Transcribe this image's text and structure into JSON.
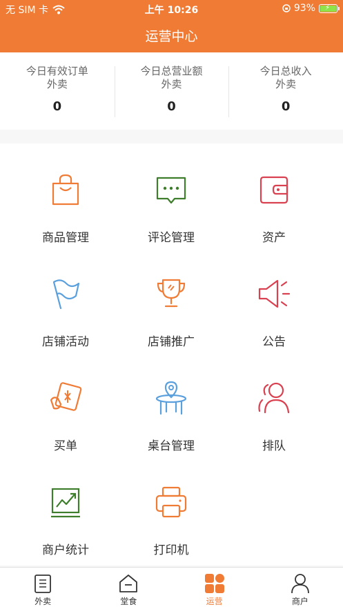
{
  "status_bar": {
    "carrier": "无 SIM 卡",
    "time": "上午 10:26",
    "battery": "93%"
  },
  "header": {
    "title": "运营中心"
  },
  "stats": [
    {
      "line1": "今日有效订单",
      "line2": "外卖",
      "value": "0"
    },
    {
      "line1": "今日总营业额",
      "line2": "外卖",
      "value": "0"
    },
    {
      "line1": "今日总收入",
      "line2": "外卖",
      "value": "0"
    }
  ],
  "menu": [
    {
      "label": "商品管理",
      "icon": "shopping-bag-icon"
    },
    {
      "label": "评论管理",
      "icon": "comment-icon"
    },
    {
      "label": "资产",
      "icon": "wallet-icon"
    },
    {
      "label": "店铺活动",
      "icon": "flag-icon"
    },
    {
      "label": "店铺推广",
      "icon": "trophy-icon"
    },
    {
      "label": "公告",
      "icon": "megaphone-icon"
    },
    {
      "label": "买单",
      "icon": "coupon-icon"
    },
    {
      "label": "桌台管理",
      "icon": "table-icon"
    },
    {
      "label": "排队",
      "icon": "people-icon"
    },
    {
      "label": "商户统计",
      "icon": "chart-icon"
    },
    {
      "label": "打印机",
      "icon": "printer-icon"
    }
  ],
  "tabs": [
    {
      "label": "外卖",
      "icon": "clipboard-icon"
    },
    {
      "label": "堂食",
      "icon": "home-icon"
    },
    {
      "label": "运营",
      "icon": "grid-icon",
      "active": true
    },
    {
      "label": "商户",
      "icon": "user-icon"
    }
  ],
  "colors": {
    "accent": "#ef7b35",
    "green": "#3e7d2b",
    "red": "#d94050",
    "blue": "#5aa0dd"
  }
}
